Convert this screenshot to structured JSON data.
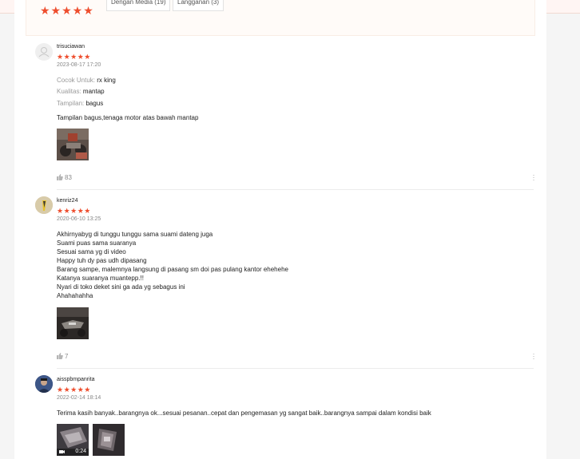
{
  "summary": {
    "stars": "★★★★★",
    "filters": [
      "Dengan Media (19)",
      "Langganan (3)"
    ]
  },
  "reviews": [
    {
      "username": "trisuciawan",
      "stars": "★★★★★",
      "date": "2023-08-17 17:20",
      "attributes": [
        {
          "key": "Cocok Untuk:",
          "value": "rx king"
        },
        {
          "key": "Kualitas:",
          "value": "mantap"
        },
        {
          "key": "Tampilan:",
          "value": "bagus"
        }
      ],
      "text": [
        "Tampilan bagus,tenaga motor atas bawah mantap"
      ],
      "likes": "83"
    },
    {
      "username": "kenriz24",
      "stars": "★★★★★",
      "date": "2020-06-10 13:25",
      "text": [
        "Akhirnyabyg di tunggu tunggu sama suami dateng juga",
        "Suami puas sama suaranya",
        "Sesuai sama yg di video",
        "Happy tuh dy pas udh dipasang",
        "Barang sampe, malemnya langsung di pasang sm doi pas pulang kantor ehehehe",
        "Katanya suaranya muantepp.!!",
        "Nyari di toko deket sini ga ada yg sebagus ini",
        "Ahahahahha"
      ],
      "likes": "7"
    },
    {
      "username": "aisspbmpanrita",
      "stars": "★★★★★",
      "date": "2022-02-14 18:14",
      "text": [
        "Terima kasih banyak..barangnya ok...sesuai pesanan..cepat dan pengemasan yg sangat baik..barangnya sampai dalam kondisi baik"
      ],
      "video_duration": "0:24"
    }
  ],
  "icons": {
    "like": "thumbs-up-icon",
    "more": "more-vertical-icon",
    "video": "video-camera-icon"
  },
  "colors": {
    "star": "#ee4d2d"
  }
}
